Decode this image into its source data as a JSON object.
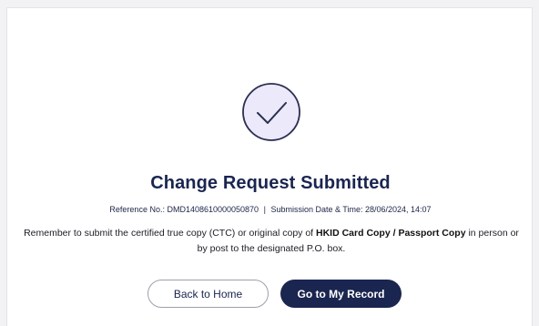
{
  "success": {
    "icon": "check-circle-icon",
    "title": "Change Request Submitted"
  },
  "reference": {
    "label": "Reference No.:",
    "value": "DMD1408610000050870",
    "separator": "|",
    "date_label": "Submission Date & Time:",
    "date_value": "28/06/2024, 14:07"
  },
  "notice": {
    "part1": "Remember to submit the certified true copy (CTC) or original copy of ",
    "bold": "HKID Card Copy / Passport Copy",
    "part2": " in person or by post to the designated P.O. box."
  },
  "actions": {
    "back_home": "Back to Home",
    "my_record": "Go to My Record"
  },
  "colors": {
    "primary": "#1a2550",
    "icon_fill": "#ece9fb",
    "icon_stroke": "#2b2f52"
  }
}
